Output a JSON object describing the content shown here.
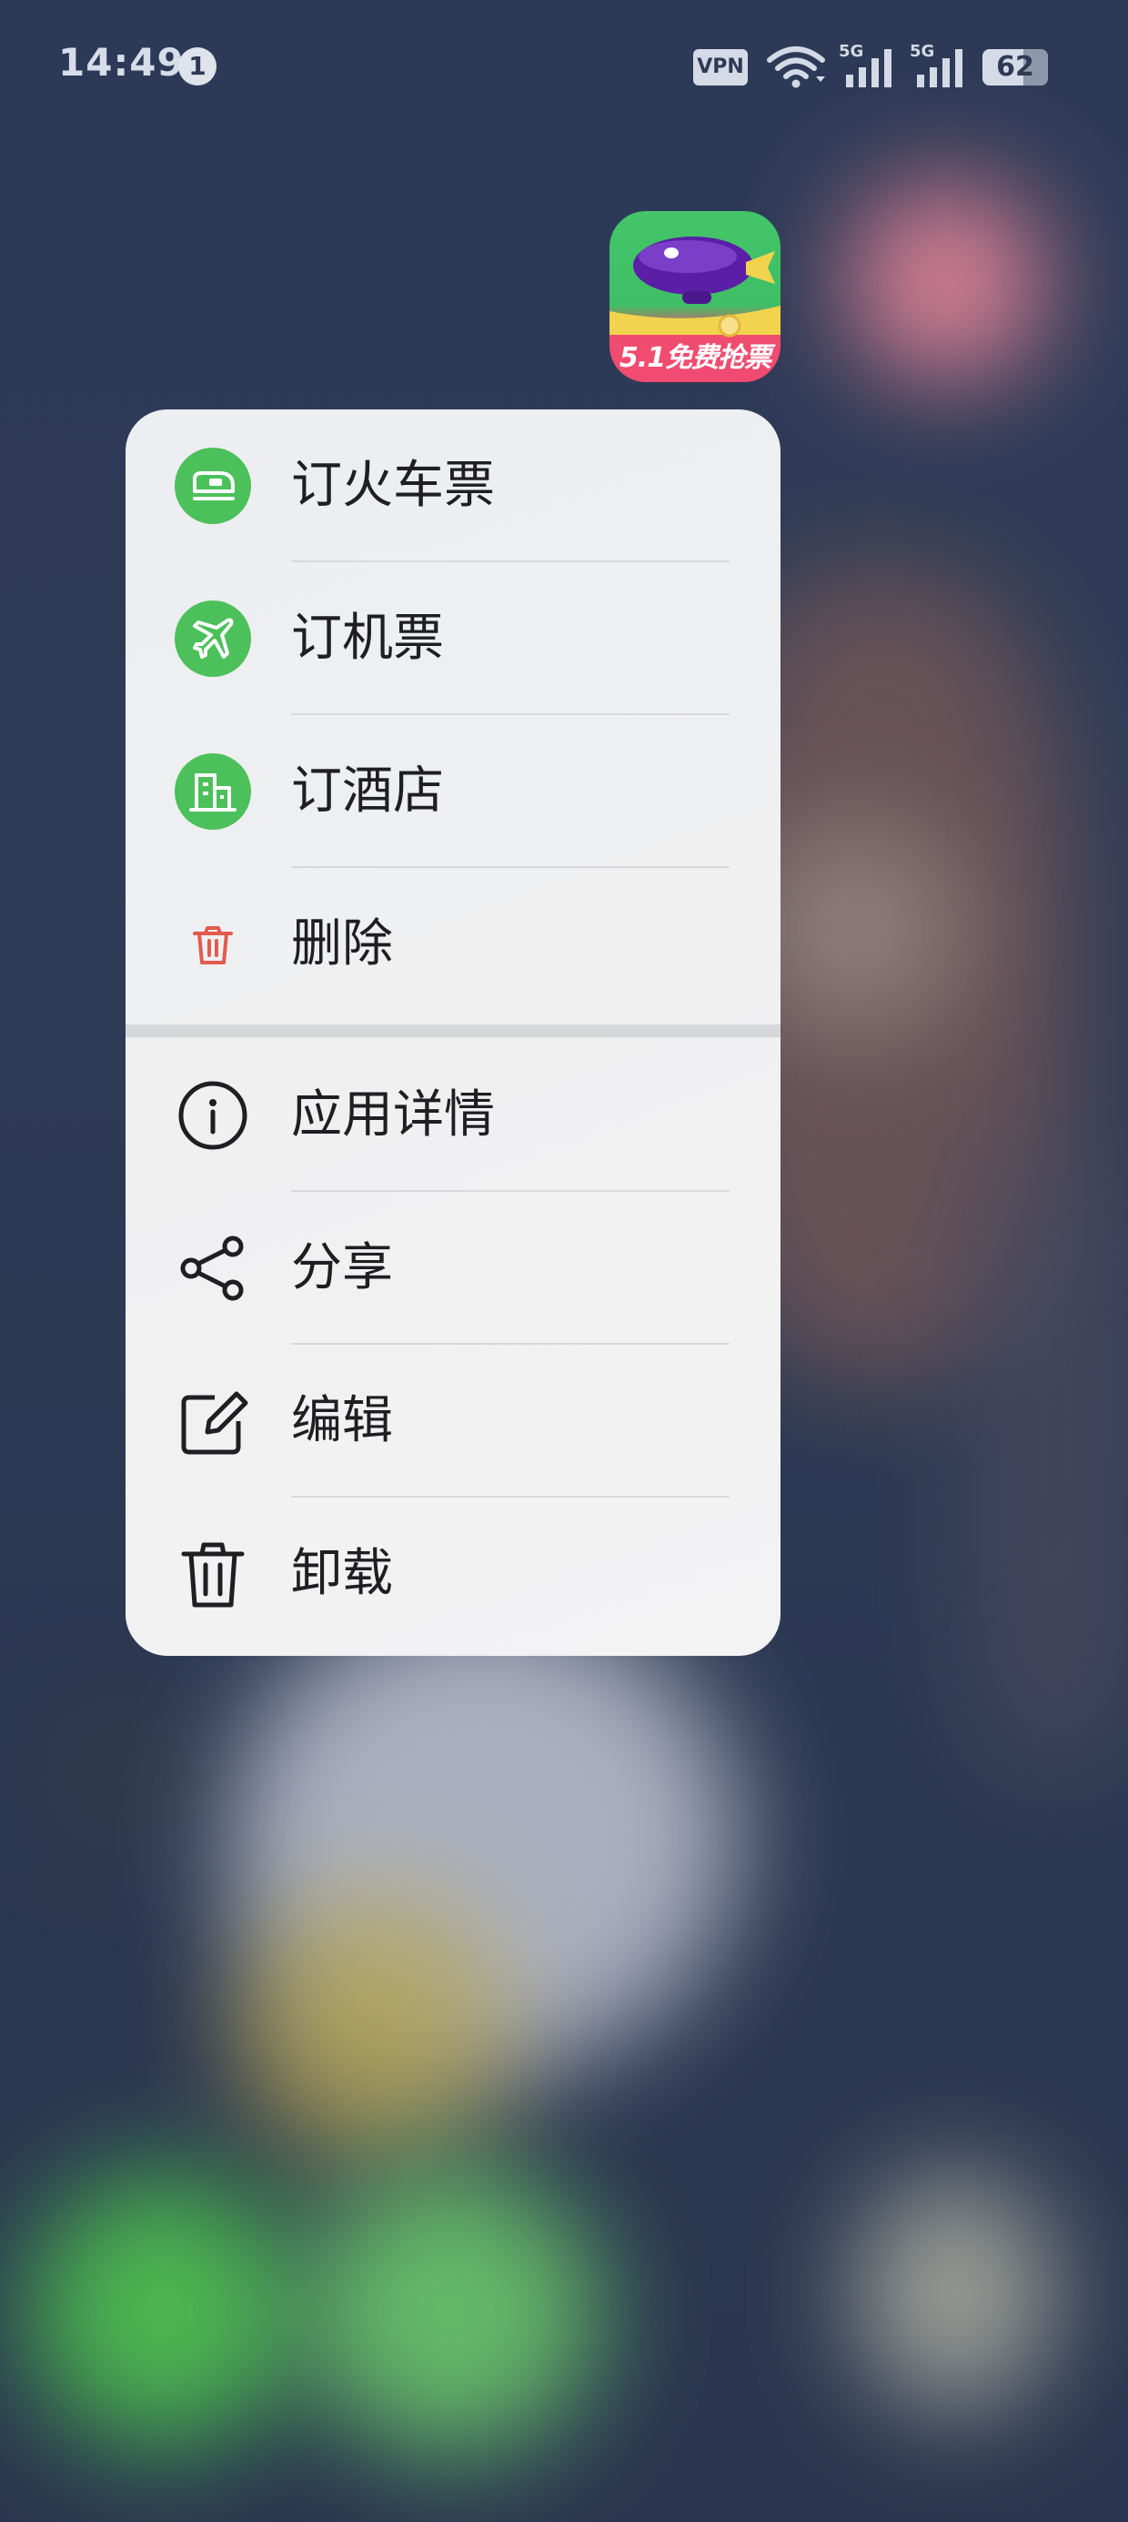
{
  "status_bar": {
    "time": "14:49",
    "notification_count": "1",
    "vpn_label": "VPN",
    "network_1": "5G",
    "network_2": "5G",
    "battery": "62"
  },
  "app": {
    "banner": "5.1免费抢票",
    "icon": "blimp-app-icon"
  },
  "menu": {
    "shortcuts": [
      {
        "label": "订火车票",
        "icon": "train-icon"
      },
      {
        "label": "订机票",
        "icon": "airplane-icon"
      },
      {
        "label": "订酒店",
        "icon": "hotel-building-icon"
      },
      {
        "label": "删除",
        "icon": "trash-icon"
      }
    ],
    "actions": [
      {
        "label": "应用详情",
        "icon": "info-icon"
      },
      {
        "label": "分享",
        "icon": "share-icon"
      },
      {
        "label": "编辑",
        "icon": "edit-icon"
      },
      {
        "label": "卸载",
        "icon": "uninstall-trash-icon"
      }
    ]
  },
  "colors": {
    "shortcut_green": "#4cc05a",
    "delete_red": "#e25b4e",
    "menu_bg": "#eeeff1",
    "text": "#1f1f22"
  }
}
